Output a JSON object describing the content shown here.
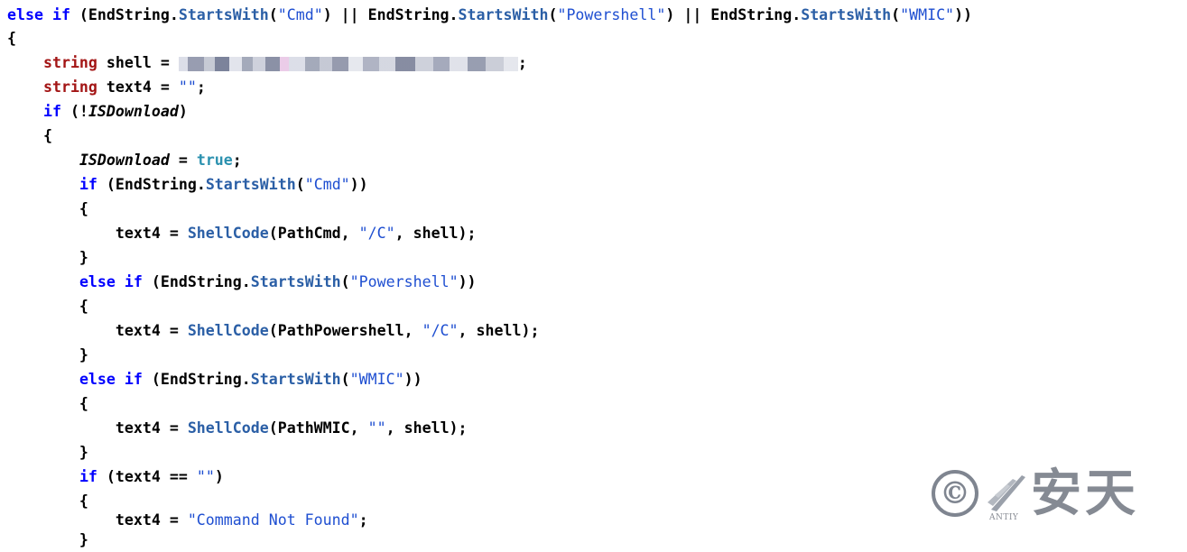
{
  "code": {
    "lines": [
      "else if (EndString.StartsWith(\"Cmd\") || EndString.StartsWith(\"Powershell\") || EndString.StartsWith(\"WMIC\"))",
      "{",
      "    string shell = [redacted];",
      "    string text4 = \"\";",
      "    if (!ISDownload)",
      "    {",
      "        ISDownload = true;",
      "        if (EndString.StartsWith(\"Cmd\"))",
      "        {",
      "            text4 = ShellCode(PathCmd, \"/C\", shell);",
      "        }",
      "        else if (EndString.StartsWith(\"Powershell\"))",
      "        {",
      "            text4 = ShellCode(PathPowershell, \"/C\", shell);",
      "        }",
      "        else if (EndString.StartsWith(\"WMIC\"))",
      "        {",
      "            text4 = ShellCode(PathWMIC, \"\", shell);",
      "        }",
      "        if (text4 == \"\")",
      "        {",
      "            text4 = \"Command Not Found\";",
      "        }"
    ]
  },
  "watermark": {
    "symbol": "©",
    "brand_en": "ANTIY",
    "brand_cn": "安天",
    "icon": "antiy-wing-logo"
  }
}
